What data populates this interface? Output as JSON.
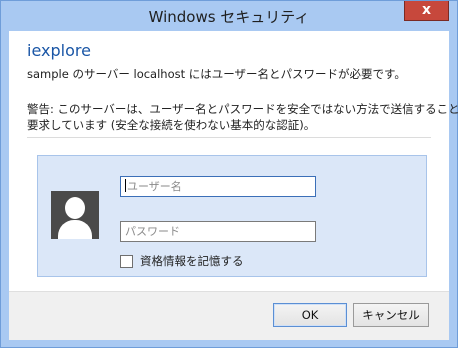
{
  "window": {
    "title": "Windows セキュリティ",
    "close_label": "x"
  },
  "dialog": {
    "app_name": "iexplore",
    "message": "sample のサーバー localhost にはユーザー名とパスワードが必要です。",
    "warning_line1": "警告: このサーバーは、ユーザー名とパスワードを安全ではない方法で送信することを",
    "warning_line2": "要求しています (安全な接続を使わない基本的な認証)。"
  },
  "credentials": {
    "avatar_icon": "user-silhouette-icon",
    "username_placeholder": "ユーザー名",
    "username_value": "",
    "password_placeholder": "パスワード",
    "password_value": "",
    "remember_label": "資格情報を記憶する",
    "remember_checked": false
  },
  "buttons": {
    "ok_label": "OK",
    "cancel_label": "キャンセル"
  },
  "colors": {
    "titlebar": "#a9c9f2",
    "close_button": "#c7483c",
    "app_name": "#1a56a6",
    "credential_panel": "#dbe7f8"
  }
}
